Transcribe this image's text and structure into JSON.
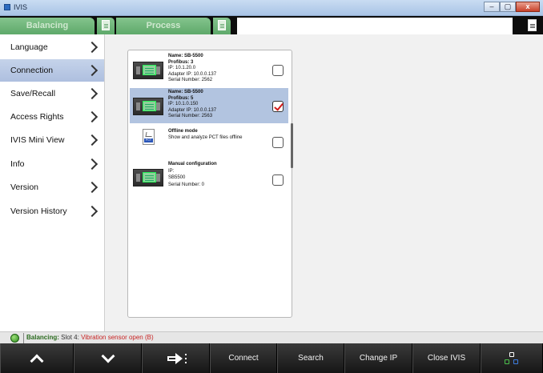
{
  "window": {
    "title": "IVIS",
    "controls": [
      "–",
      "▢",
      "x"
    ]
  },
  "tabs": [
    {
      "label": "Balancing",
      "active": false
    },
    {
      "label": "Process",
      "active": false
    }
  ],
  "sidebar": {
    "items": [
      {
        "label": "Language"
      },
      {
        "label": "Connection",
        "active": true
      },
      {
        "label": "Save/Recall"
      },
      {
        "label": "Access Rights"
      },
      {
        "label": "IVIS Mini View"
      },
      {
        "label": "Info"
      },
      {
        "label": "Version"
      },
      {
        "label": "Version History"
      }
    ]
  },
  "devices": [
    {
      "name": "Name: SB-5500",
      "profibus": "Profibus: 3",
      "ip": "IP: 10.1.20.0",
      "adapter_ip": "Adapter IP: 10.0.0.137",
      "serial": "Serial Number: 2562",
      "checked": false,
      "selected": false
    },
    {
      "name": "Name: SB-5500",
      "profibus": "Profibus: 5",
      "ip": "IP: 10.1.0.150",
      "adapter_ip": "Adapter IP: 10.0.0.137",
      "serial": "Serial Number: 2563",
      "checked": true,
      "selected": true
    },
    {
      "title": "Offline mode",
      "description": "Show and analyze PCT files offline",
      "icon_tag": "PCT",
      "checked": false
    },
    {
      "title": "Manual configuration",
      "ip": "IP:",
      "model": "SB5500",
      "serial": "Serial Number:  0",
      "checked": false
    }
  ],
  "status": {
    "label": "Balancing:",
    "slot": "Slot 4:",
    "message": "Vibration sensor open (B)",
    "indicator_color": "#3fae2a"
  },
  "toolbar": {
    "up_icon": "chevron-up-icon",
    "down_icon": "chevron-down-icon",
    "next_icon": "next-arrow-icon",
    "connect": "Connect",
    "search": "Search",
    "change_ip": "Change IP",
    "close_ivis": "Close IVIS",
    "network_icon": "network-icon"
  },
  "colors": {
    "tab_green": "#6fb67a",
    "selected_row": "#b2c4e0",
    "check_red": "#d21a1a",
    "status_red": "#c82424"
  }
}
